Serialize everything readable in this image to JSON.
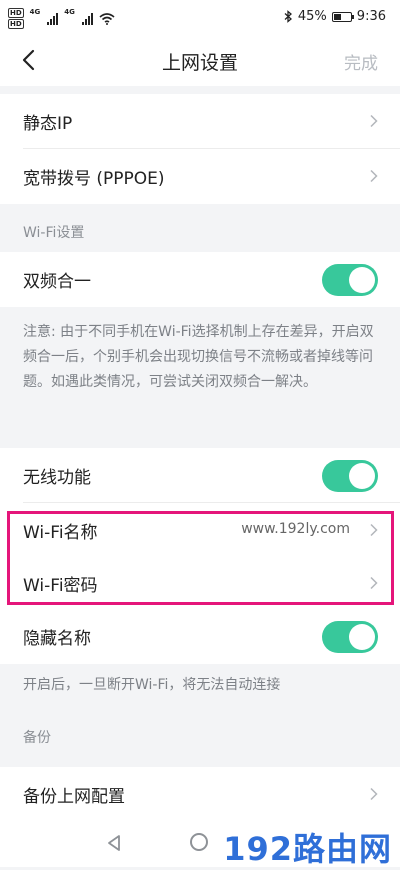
{
  "status_bar": {
    "network_a": "4G",
    "network_b": "4G",
    "hd_a": "HD",
    "hd_b": "HD",
    "battery": "45%",
    "battery_level": 0.45,
    "time": "9:36"
  },
  "nav": {
    "title": "上网设置",
    "done": "完成"
  },
  "network": {
    "static_ip": "静态IP",
    "pppoe": "宽带拨号 (PPPOE)"
  },
  "wifi_section": {
    "title": "Wi-Fi设置",
    "dual_band_label": "双频合一",
    "dual_band_on": true,
    "note": "注意: 由于不同手机在Wi-Fi选择机制上存在差异，开启双频合一后，个别手机会出现切换信号不流畅或者掉线等问题。如遇此类情况，可尝试关闭双频合一解决。",
    "wireless_label": "无线功能",
    "wireless_on": true,
    "wifi_name_label": "Wi-Fi名称",
    "wifi_name_value": "www.192ly.com",
    "wifi_password_label": "Wi-Fi密码",
    "hide_name_label": "隐藏名称",
    "hide_name_on": true,
    "hide_note": "开启后，一旦断开Wi-Fi，将无法自动连接"
  },
  "backup_section": {
    "title": "备份",
    "backup_config_label": "备份上网配置"
  },
  "watermark": "192路由网",
  "colors": {
    "toggle_on": "#38c89b",
    "highlight": "#e5157a",
    "watermark": "#2f6fd8"
  }
}
